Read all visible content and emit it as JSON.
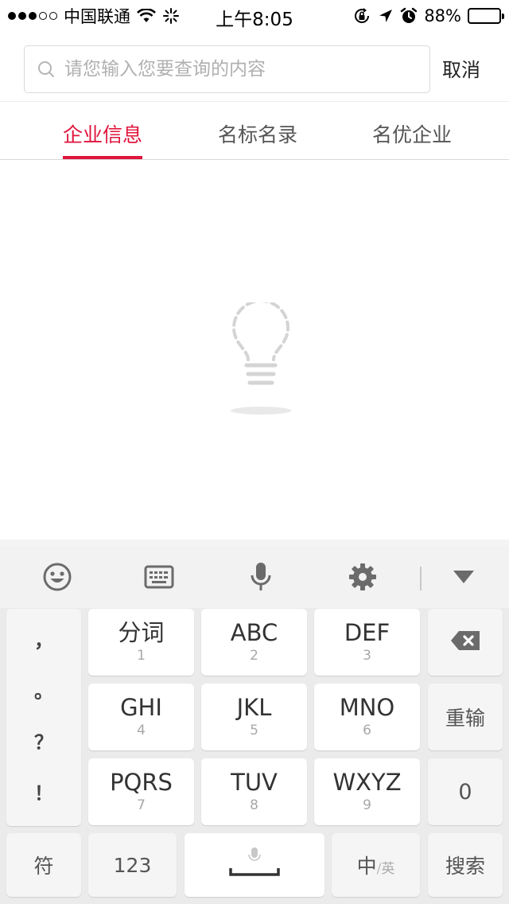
{
  "status_bar": {
    "carrier": "中国联通",
    "time": "上午8:05",
    "battery_percent": "88%",
    "battery_level": 0.88
  },
  "search": {
    "placeholder": "请您输入您要查询的内容",
    "value": "",
    "cancel_label": "取消"
  },
  "tabs": [
    {
      "label": "企业信息",
      "active": true
    },
    {
      "label": "名标名录",
      "active": false
    },
    {
      "label": "名优企业",
      "active": false
    }
  ],
  "colors": {
    "accent": "#e0143c",
    "keyboard_bg": "#ebebeb"
  },
  "keyboard": {
    "toolbar_icons": [
      "emoji-icon",
      "keyboard-icon",
      "microphone-icon",
      "settings-gear-icon",
      "collapse-triangle-icon"
    ],
    "punctuation": [
      "，",
      "。",
      "？",
      "！"
    ],
    "rows": [
      [
        {
          "main": "分词",
          "sub": "1"
        },
        {
          "main": "ABC",
          "sub": "2"
        },
        {
          "main": "DEF",
          "sub": "3"
        }
      ],
      [
        {
          "main": "GHI",
          "sub": "4"
        },
        {
          "main": "JKL",
          "sub": "5"
        },
        {
          "main": "MNO",
          "sub": "6"
        }
      ],
      [
        {
          "main": "PQRS",
          "sub": "7"
        },
        {
          "main": "TUV",
          "sub": "8"
        },
        {
          "main": "WXYZ",
          "sub": "9"
        }
      ]
    ],
    "reinput_label": "重输",
    "zero_label": "0",
    "symbol_label": "符",
    "numeric_label": "123",
    "lang_zh": "中",
    "lang_sep": "/",
    "lang_en": "英",
    "search_label": "搜索"
  }
}
